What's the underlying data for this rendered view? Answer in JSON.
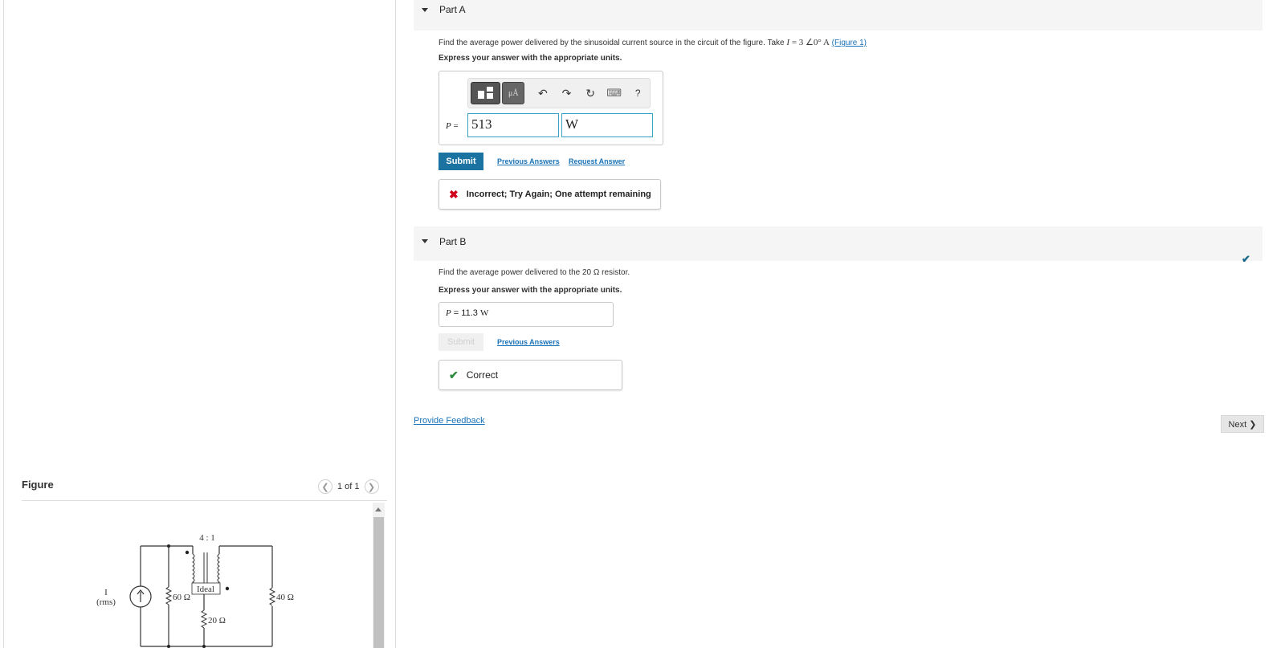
{
  "figure": {
    "title": "Figure",
    "pager_text": "1 of 1",
    "circuit": {
      "source_label": "I",
      "source_sub": "(rms)",
      "r1": "60 Ω",
      "ratio": "4 : 1",
      "ideal": "Ideal",
      "r2": "20 Ω",
      "r3": "40 Ω"
    }
  },
  "partA": {
    "label": "Part A",
    "question_pre": "Find the average power delivered by the sinusoidal current source in the circuit of the figure. Take",
    "question_math_var": "I",
    "question_math_val": " = 3 ∠0° ",
    "question_math_unit": "A",
    "figure_link": "(Figure 1)",
    "units_note": "Express your answer with the appropriate units.",
    "toolbar": {
      "template_label": "▪▫",
      "units_label": "μÅ",
      "undo": "↶",
      "redo": "↷",
      "reset": "↻",
      "keyboard": "⌨",
      "help": "?"
    },
    "answer_label_var": "P",
    "answer_label_eq": " = ",
    "value": "513",
    "unit": "W",
    "submit": "Submit",
    "previous_answers": "Previous Answers",
    "request_answer": "Request Answer",
    "feedback": "Incorrect; Try Again; One attempt remaining",
    "feedback_icon": "✖"
  },
  "partB": {
    "label": "Part B",
    "question": "Find the average power delivered to the 20 Ω resistor.",
    "units_note": "Express your answer with the appropriate units.",
    "answer_var": "P",
    "answer_eq": " = ",
    "answer_value": " 11.3 ",
    "answer_unit": "W",
    "submit": "Submit",
    "previous_answers": "Previous Answers",
    "feedback": "Correct",
    "feedback_icon": "✔",
    "status_icon": "✔"
  },
  "footer": {
    "provide_feedback": "Provide Feedback",
    "next": "Next ❯"
  },
  "colors": {
    "accent": "#1a73a0",
    "link": "#1a73b8",
    "incorrect": "#d0021b",
    "correct": "#2e8b3d"
  }
}
